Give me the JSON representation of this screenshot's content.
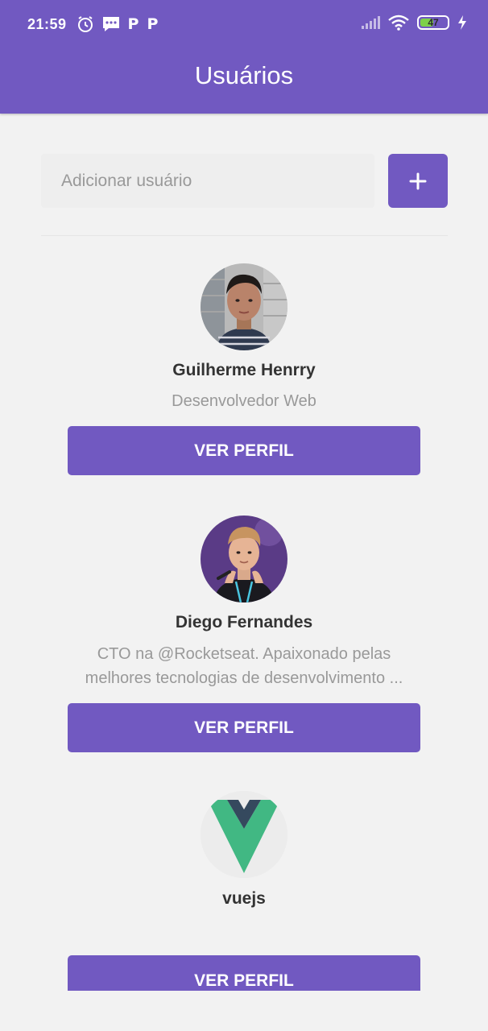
{
  "status": {
    "time": "21:59",
    "battery": "47",
    "icons_left": [
      "alarm-icon",
      "message-icon",
      "p-icon",
      "p-icon"
    ],
    "icons_right": [
      "signal-icon",
      "wifi-icon",
      "battery-icon",
      "charging-icon"
    ]
  },
  "header": {
    "title": "Usuários"
  },
  "form": {
    "placeholder": "Adicionar usuário",
    "value": "",
    "add_label": "+"
  },
  "users": [
    {
      "name": "Guilherme Henrry",
      "bio": "Desenvolvedor Web",
      "button": "VER PERFIL"
    },
    {
      "name": "Diego Fernandes",
      "bio": "CTO na @Rocketseat. Apaixonado pelas melhores tecnologias de desenvolvimento ...",
      "button": "VER PERFIL"
    },
    {
      "name": "vuejs",
      "bio": "",
      "button": "VER PERFIL"
    }
  ],
  "colors": {
    "primary": "#7159c1",
    "background": "#f2f2f2",
    "name": "#333333",
    "bio": "#999999"
  }
}
